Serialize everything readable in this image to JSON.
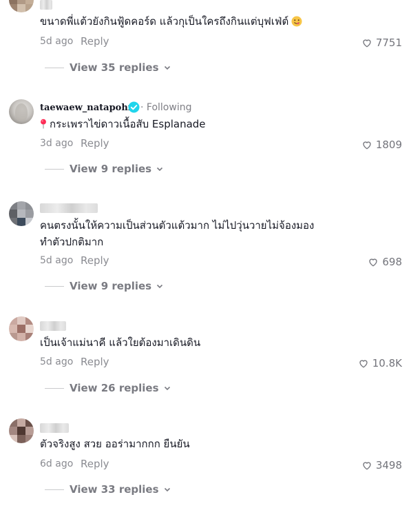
{
  "comments": [
    {
      "username": "",
      "text": "ขนาดพี่แต้วยังกินฟู้ดคอร์ด แล้วกุเป็นใครถึงกินแต่บุฟเฟ่ต์",
      "emoji": "face-savoring-food",
      "time": "5d ago",
      "reply_label": "Reply",
      "likes": "7751",
      "view_replies": "View 35 replies"
    },
    {
      "username": "taewaew_natapohn",
      "verified": true,
      "following_label": "Following",
      "text_prefix_icon": "round-pushpin",
      "text": "กระเพราไข่ดาวเนื้อสับ Esplanade",
      "time": "3d ago",
      "reply_label": "Reply",
      "likes": "1809",
      "view_replies": "View 9 replies"
    },
    {
      "username": "",
      "text_lines": [
        "คนตรงนั้นให้ความเป็นส่วนตัวแต้วมาก ไม่ไปวุ่นวายไม่จ้องมอง",
        "ทำตัวปกติมาก"
      ],
      "time": "5d ago",
      "reply_label": "Reply",
      "likes": "698",
      "view_replies": "View 9 replies"
    },
    {
      "username": "",
      "text": "เป็นเจ้าแม่นาคี แล้วใยต้องมาเดินดิน",
      "time": "5d ago",
      "reply_label": "Reply",
      "likes": "10.8K",
      "view_replies": "View 26 replies"
    },
    {
      "username": "",
      "text": "ตัวจริงสูง สวย ออร่ามากกก ยืนยัน",
      "time": "6d ago",
      "reply_label": "Reply",
      "likes": "3498",
      "view_replies": "View 33 replies"
    }
  ],
  "colors": {
    "primary_text": "#161823",
    "secondary_text": "#8a8b91",
    "verified_badge": "#20d5ec",
    "pin": "#fe2c55"
  }
}
